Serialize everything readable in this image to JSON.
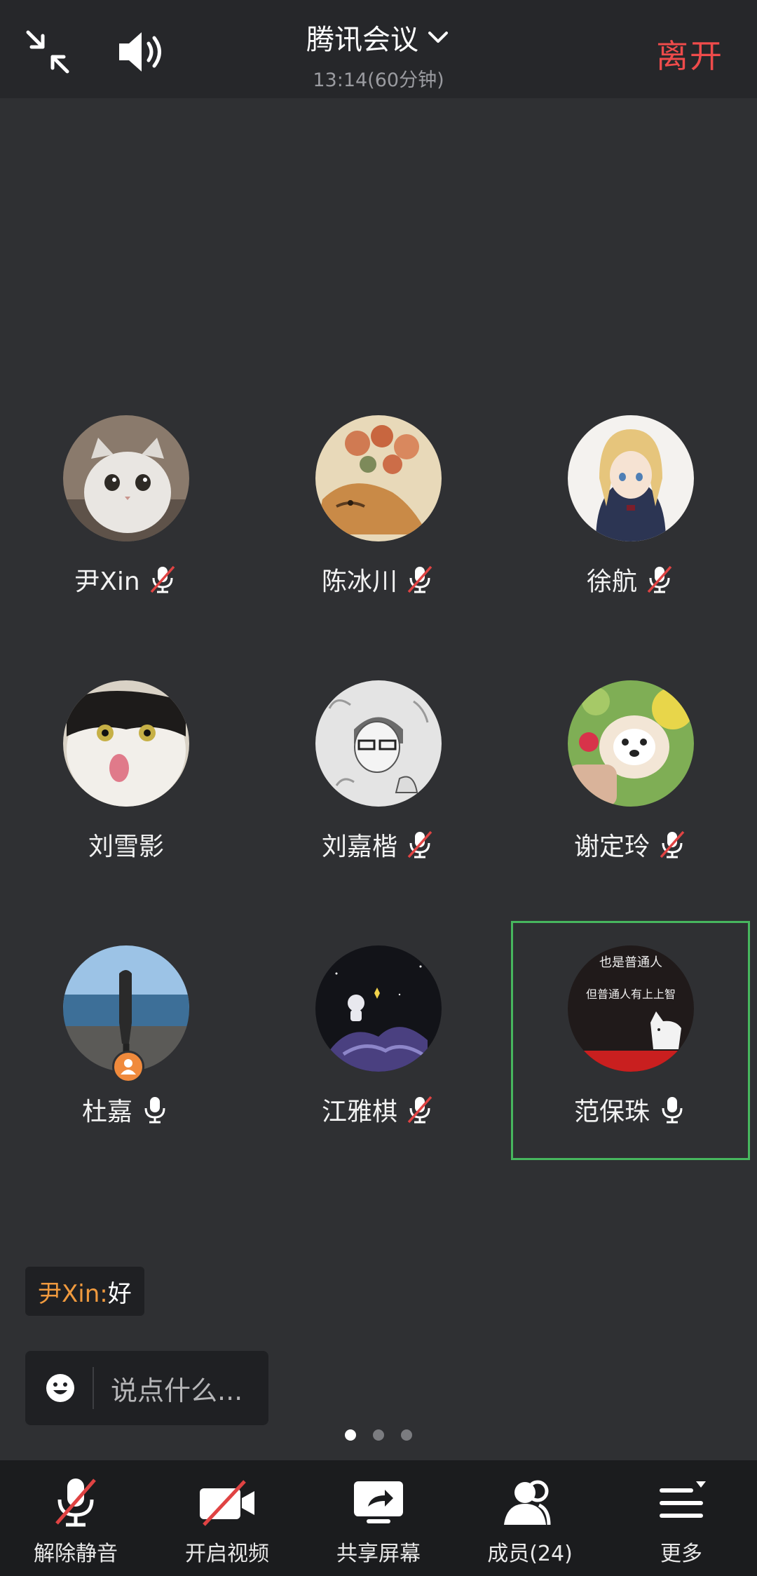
{
  "header": {
    "title": "腾讯会议",
    "subtitle": "13:14(60分钟)",
    "leave_label": "离开",
    "icons": [
      "minimize-icon",
      "speaker-icon",
      "chevron-down-icon"
    ]
  },
  "participants": [
    {
      "name": "尹Xin",
      "mic": "muted",
      "avatar": "white-cat"
    },
    {
      "name": "陈冰川",
      "mic": "muted",
      "avatar": "tiger-flowers"
    },
    {
      "name": "徐航",
      "mic": "muted",
      "avatar": "anime-girl"
    },
    {
      "name": "刘雪影",
      "mic": "none",
      "avatar": "black-white-cat"
    },
    {
      "name": "刘嘉楷",
      "mic": "muted",
      "avatar": "sketch-man"
    },
    {
      "name": "谢定玲",
      "mic": "muted",
      "avatar": "puppy"
    },
    {
      "name": "杜嘉",
      "mic": "on",
      "avatar": "person-seaside",
      "badge": "speaker-badge"
    },
    {
      "name": "江雅棋",
      "mic": "muted",
      "avatar": "astronaut-night"
    },
    {
      "name": "范保珠",
      "mic": "on",
      "avatar": "text-cat",
      "active": true
    }
  ],
  "avatar_texts": {
    "line1": "也是普通人",
    "line2": "但普通人有上上智"
  },
  "chat": {
    "author": "尹Xin: ",
    "text": "好",
    "input_placeholder": "说点什么..."
  },
  "pager": {
    "pages": 3,
    "current": 1
  },
  "toolbar": [
    {
      "label": "解除静音",
      "icon": "mic-muted-icon"
    },
    {
      "label": "开启视频",
      "icon": "camera-off-icon"
    },
    {
      "label": "共享屏幕",
      "icon": "share-screen-icon"
    },
    {
      "label": "成员(24)",
      "icon": "members-icon"
    },
    {
      "label": "更多",
      "icon": "more-icon"
    }
  ],
  "colors": {
    "background": "#2f3033",
    "topbar": "#26272a",
    "leave": "#ef4b4b",
    "active_border": "#47b65e",
    "chat_author": "#f09a3e",
    "mute_slash": "#e04343"
  }
}
